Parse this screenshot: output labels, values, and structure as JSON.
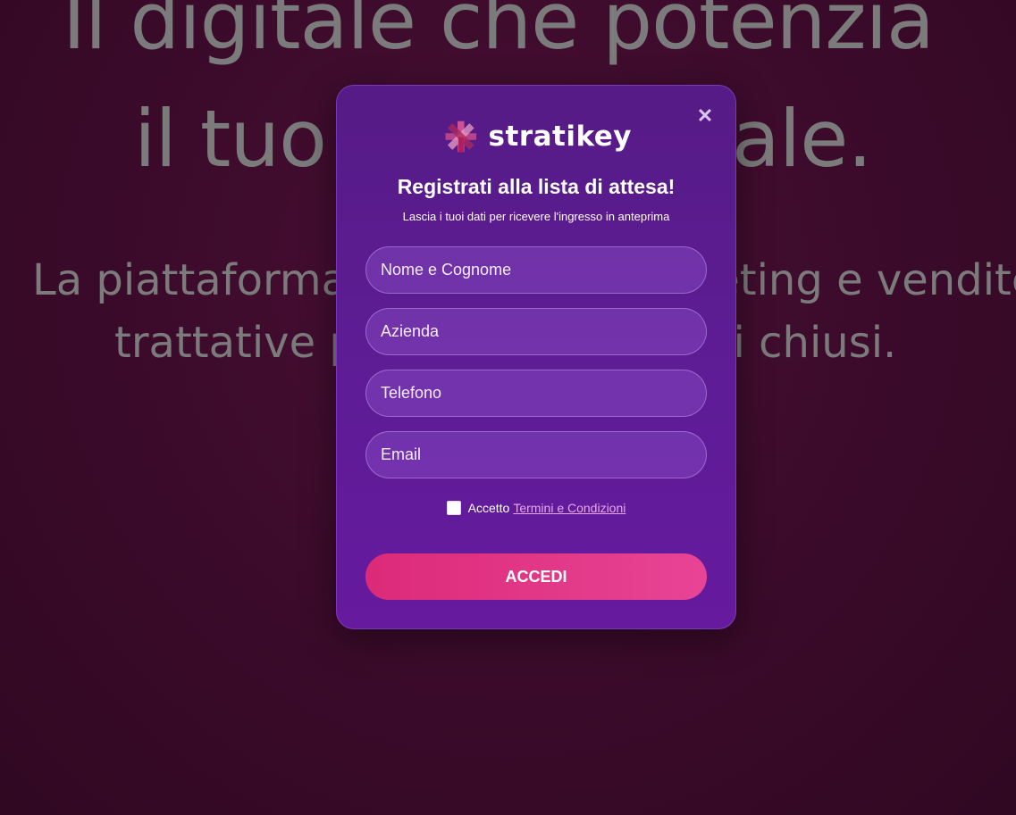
{
  "hero": {
    "headline_line1": "Il digitale che potenzia",
    "headline_line2": "il tuo commerciale.",
    "sub_line1": "La piattaforma che unisce marketing e vendite",
    "sub_line2": "trattative più veloci, contratti chiusi."
  },
  "modal": {
    "brand": "stratikey",
    "title": "Registrati alla lista di attesa!",
    "subtitle": "Lascia i tuoi dati per ricevere l'ingresso in anteprima",
    "fields": {
      "name_placeholder": "Nome e Cognome",
      "company_placeholder": "Azienda",
      "phone_placeholder": "Telefono",
      "email_placeholder": "Email"
    },
    "terms_prefix": "Accetto",
    "terms_link": "Termini e Condizioni",
    "submit_label": "ACCEDI",
    "close_icon": "close-icon"
  },
  "colors": {
    "modal_bg": "#5e1c96",
    "accent": "#e03a88",
    "page_bg": "#3d0b2c"
  }
}
